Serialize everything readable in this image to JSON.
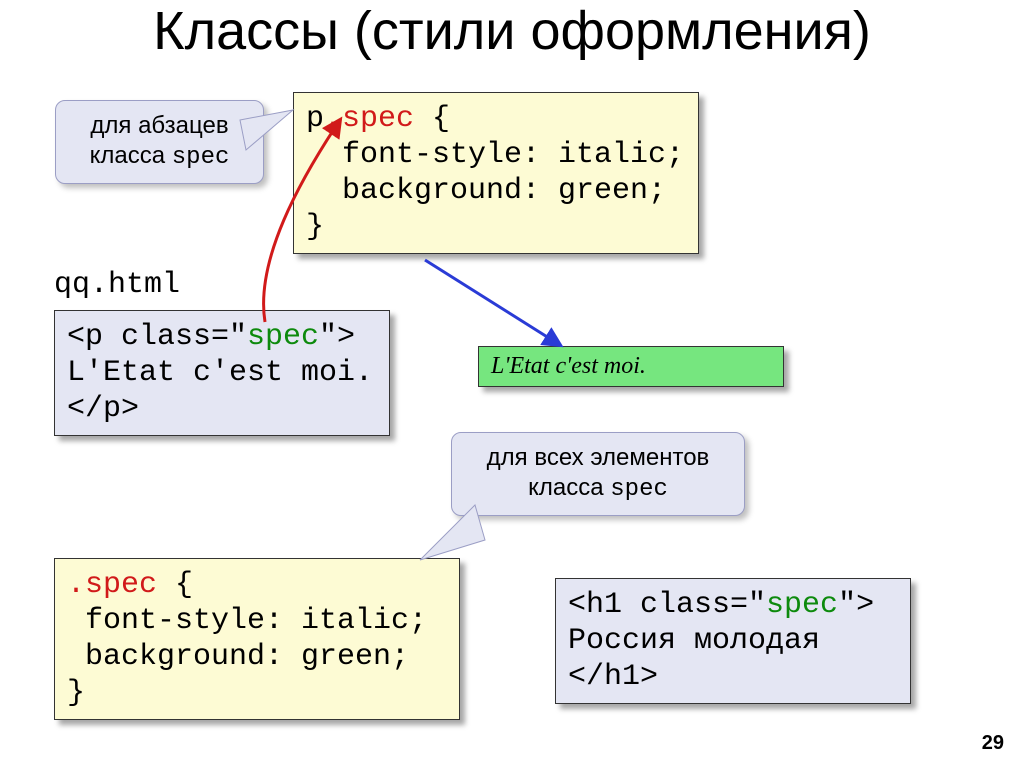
{
  "title": "Классы (стили оформления)",
  "callout1_line1": "для абзацев",
  "callout1_line2_a": "класса ",
  "callout1_line2_b": "spec",
  "css1": {
    "l1a": "p",
    "l1b": ".spec",
    "l1c": " {",
    "l2": "  font-style: italic;",
    "l3": "  background: green;",
    "l4": "}"
  },
  "filename": "qq.html",
  "html1": {
    "l1a": "<p class=\"",
    "l1b": "spec",
    "l1c": "\">",
    "l2": "L'Etat c'est moi.",
    "l3": "</p>"
  },
  "rendered": "L'Etat c'est moi.",
  "callout2_line1": "для всех элементов",
  "callout2_line2_a": "класса ",
  "callout2_line2_b": "spec",
  "css2": {
    "l1a": ".spec",
    "l1b": " {",
    "l2": " font-style: italic;",
    "l3": " background: green;",
    "l4": "}"
  },
  "html2": {
    "l1a": "<h1 class=\"",
    "l1b": "spec",
    "l1c": "\">",
    "l2": "Россия молодая",
    "l3": "</h1>"
  },
  "page": "29"
}
